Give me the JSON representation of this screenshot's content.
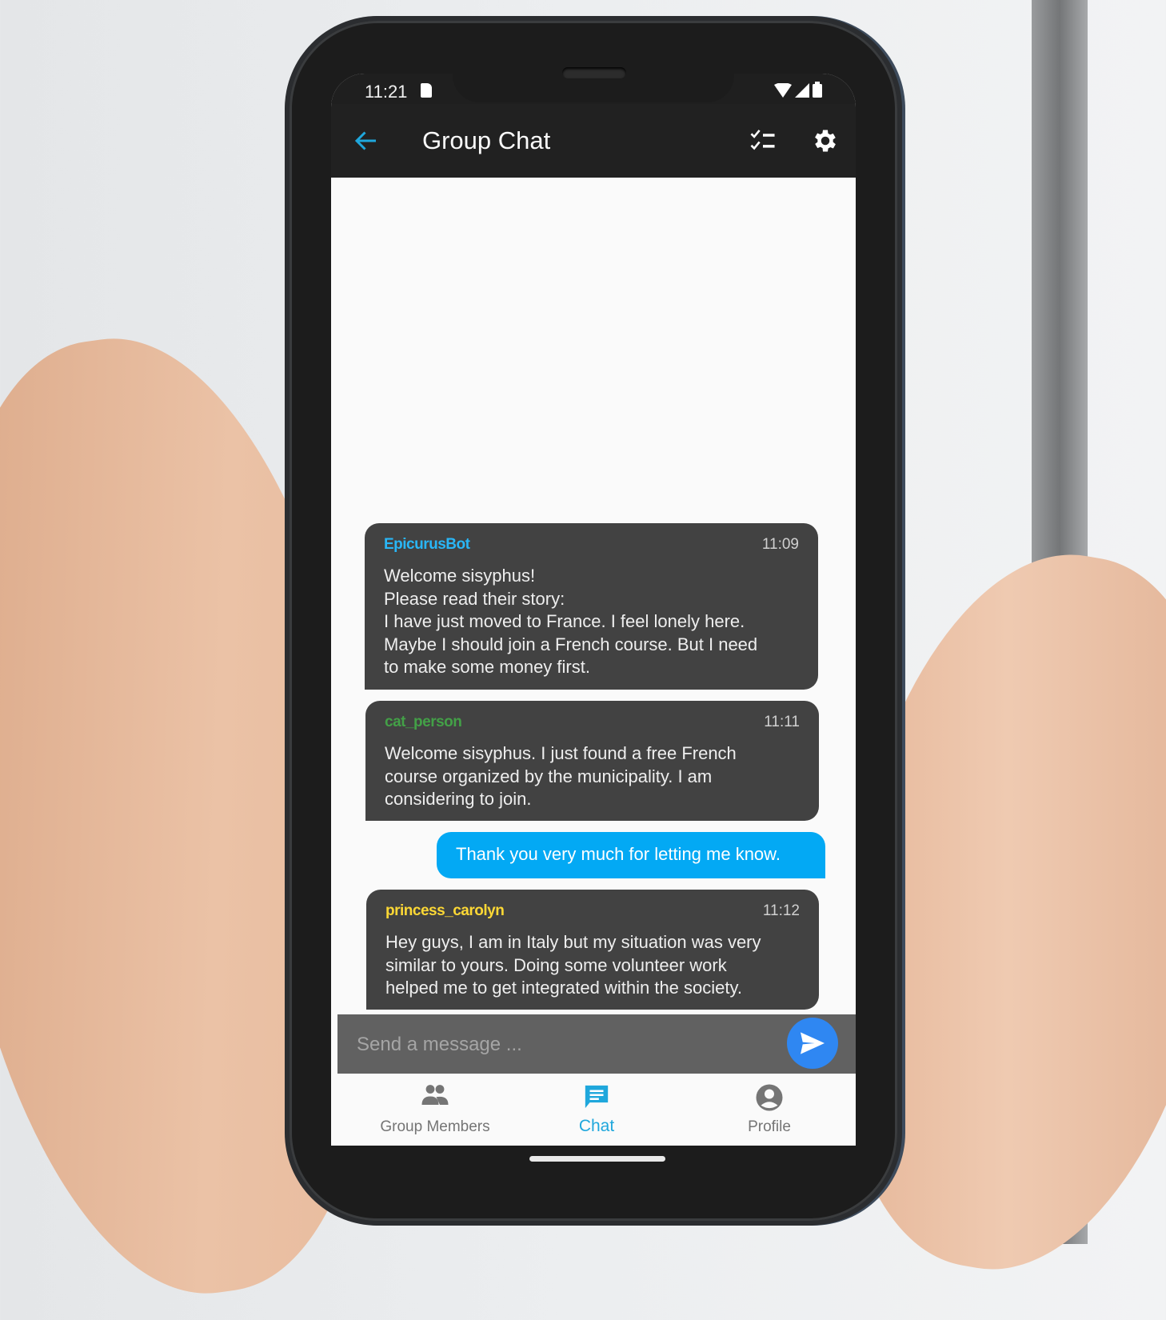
{
  "status_bar": {
    "time": "11:21",
    "icons": [
      "sd-card-icon",
      "wifi-icon",
      "signal-icon",
      "battery-icon"
    ]
  },
  "app_bar": {
    "title": "Group Chat",
    "back_icon": "arrow-back-icon",
    "actions": [
      "checklist-icon",
      "settings-icon"
    ],
    "accent_color": "#1FA7DC"
  },
  "messages": [
    {
      "sender": "EpicurusBot",
      "sender_color": "#29B6F6",
      "time": "11:09",
      "text": "Welcome sisyphus!\nPlease read their story:\nI have just moved to France. I feel lonely here.\nMaybe I should join a French course. But I need\nto make some money first.",
      "outgoing": false
    },
    {
      "sender": "cat_person",
      "sender_color": "#43A047",
      "time": "11:11",
      "text": "Welcome sisyphus. I just found a free French\ncourse organized by the municipality. I am\nconsidering to join.",
      "outgoing": false
    },
    {
      "text": "Thank you very much for letting me know.",
      "outgoing": true,
      "bubble_color": "#03A9F4"
    },
    {
      "sender": "princess_carolyn",
      "sender_color": "#FDD835",
      "time": "11:12",
      "text": "Hey guys, I am in Italy but my situation was very\nsimilar to yours. Doing some volunteer work\nhelped me to get integrated within the society.",
      "outgoing": false
    }
  ],
  "composer": {
    "placeholder": "Send a message ...",
    "value": "",
    "send_icon": "send-icon"
  },
  "bottom_nav": {
    "items": [
      {
        "label": "Group Members",
        "icon": "group-icon",
        "active": false
      },
      {
        "label": "Chat",
        "icon": "chat-icon",
        "active": true
      },
      {
        "label": "Profile",
        "icon": "account-circle-icon",
        "active": false
      }
    ]
  }
}
